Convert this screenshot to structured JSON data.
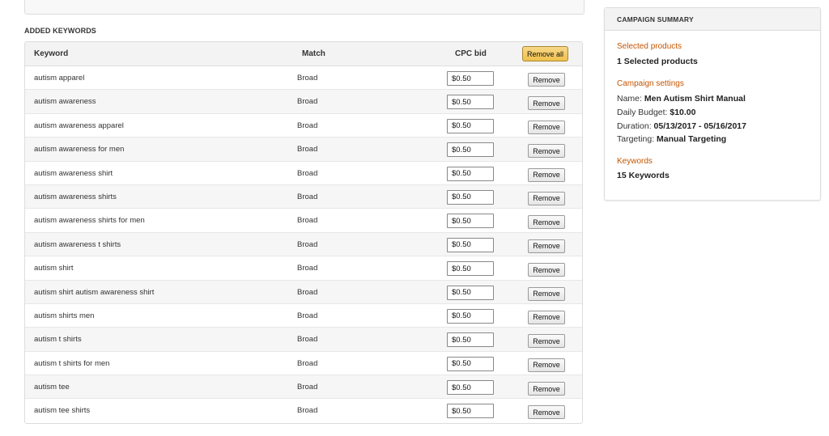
{
  "section_title": "ADDED KEYWORDS",
  "table": {
    "headers": {
      "keyword": "Keyword",
      "match": "Match",
      "cpc_bid": "CPC bid"
    },
    "remove_all_label": "Remove all",
    "remove_label": "Remove",
    "rows": [
      {
        "keyword": "autism apparel",
        "match": "Broad",
        "bid": "$0.50"
      },
      {
        "keyword": "autism awareness",
        "match": "Broad",
        "bid": "$0.50"
      },
      {
        "keyword": "autism awareness apparel",
        "match": "Broad",
        "bid": "$0.50"
      },
      {
        "keyword": "autism awareness for men",
        "match": "Broad",
        "bid": "$0.50"
      },
      {
        "keyword": "autism awareness shirt",
        "match": "Broad",
        "bid": "$0.50"
      },
      {
        "keyword": "autism awareness shirts",
        "match": "Broad",
        "bid": "$0.50"
      },
      {
        "keyword": "autism awareness shirts for men",
        "match": "Broad",
        "bid": "$0.50"
      },
      {
        "keyword": "autism awareness t shirts",
        "match": "Broad",
        "bid": "$0.50"
      },
      {
        "keyword": "autism shirt",
        "match": "Broad",
        "bid": "$0.50"
      },
      {
        "keyword": "autism shirt autism awareness shirt",
        "match": "Broad",
        "bid": "$0.50"
      },
      {
        "keyword": "autism shirts men",
        "match": "Broad",
        "bid": "$0.50"
      },
      {
        "keyword": "autism t shirts",
        "match": "Broad",
        "bid": "$0.50"
      },
      {
        "keyword": "autism t shirts for men",
        "match": "Broad",
        "bid": "$0.50"
      },
      {
        "keyword": "autism tee",
        "match": "Broad",
        "bid": "$0.50"
      },
      {
        "keyword": "autism tee shirts",
        "match": "Broad",
        "bid": "$0.50"
      }
    ]
  },
  "summary": {
    "title": "CAMPAIGN SUMMARY",
    "selected_products_label": "Selected products",
    "selected_products_value": "1 Selected products",
    "campaign_settings_label": "Campaign settings",
    "name_label": "Name:",
    "name_value": "Men Autism Shirt Manual",
    "daily_budget_label": "Daily Budget:",
    "daily_budget_value": "$10.00",
    "duration_label": "Duration:",
    "duration_value": "05/13/2017 - 05/16/2017",
    "targeting_label": "Targeting:",
    "targeting_value": "Manual Targeting",
    "keywords_label": "Keywords",
    "keywords_value": "15 Keywords"
  },
  "colors": {
    "accent_label": "#c45500",
    "remove_all_button": "#f0c14b"
  }
}
